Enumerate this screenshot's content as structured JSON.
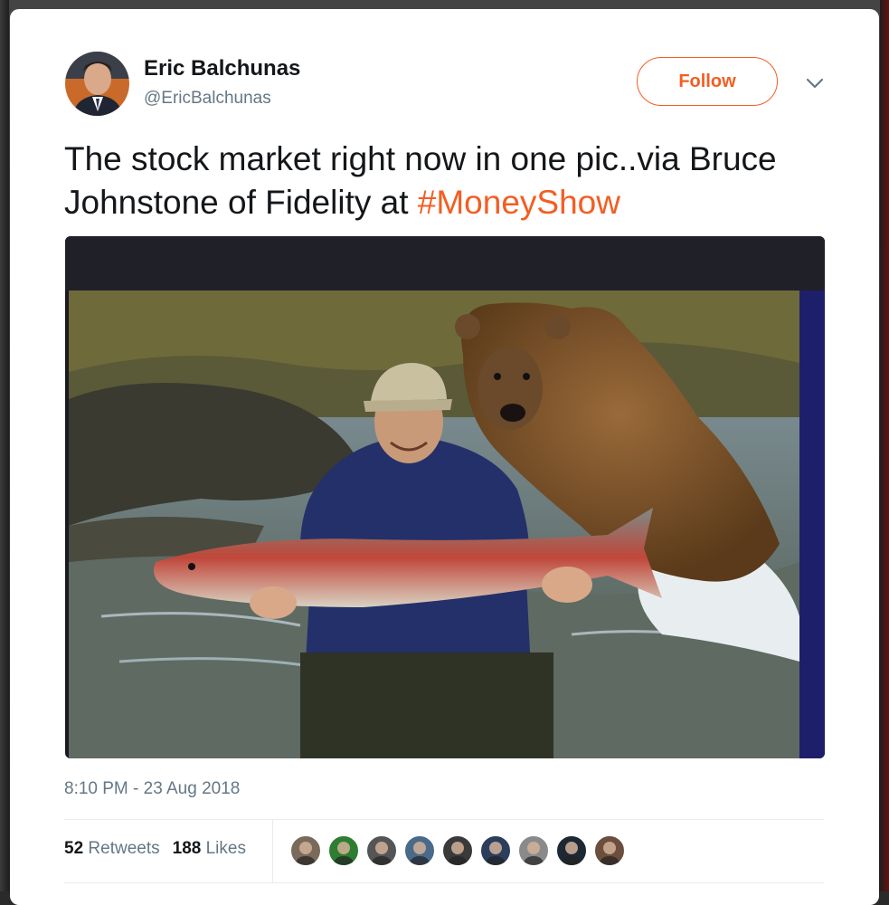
{
  "tweet": {
    "author_name": "Eric Balchunas",
    "author_handle": "@EricBalchunas",
    "follow_label": "Follow",
    "text_before": "The stock market right now in one pic..via Bruce Johnstone of Fidelity at ",
    "hashtag": "#MoneyShow",
    "timestamp": "8:10 PM - 23 Aug 2018",
    "retweets_count": "52",
    "retweets_label": "Retweets",
    "likes_count": "188",
    "likes_label": "Likes",
    "liker_avatars": [
      {
        "name": "liker-avatar-1",
        "color": "#7a6a5a"
      },
      {
        "name": "liker-avatar-2",
        "color": "#2e7d32"
      },
      {
        "name": "liker-avatar-3",
        "color": "#555555"
      },
      {
        "name": "liker-avatar-4",
        "color": "#4a6a8a"
      },
      {
        "name": "liker-avatar-5",
        "color": "#3a3a3a"
      },
      {
        "name": "liker-avatar-6",
        "color": "#2b3e5c"
      },
      {
        "name": "liker-avatar-7",
        "color": "#8a8a8a"
      },
      {
        "name": "liker-avatar-8",
        "color": "#1c2833"
      },
      {
        "name": "liker-avatar-9",
        "color": "#6b4e3d"
      }
    ]
  },
  "colors": {
    "accent": "#f45d22",
    "text_primary": "#14171a",
    "text_secondary": "#657786",
    "divider": "#e6ecf0"
  },
  "icons": {
    "more_menu": "chevron-down-icon"
  }
}
